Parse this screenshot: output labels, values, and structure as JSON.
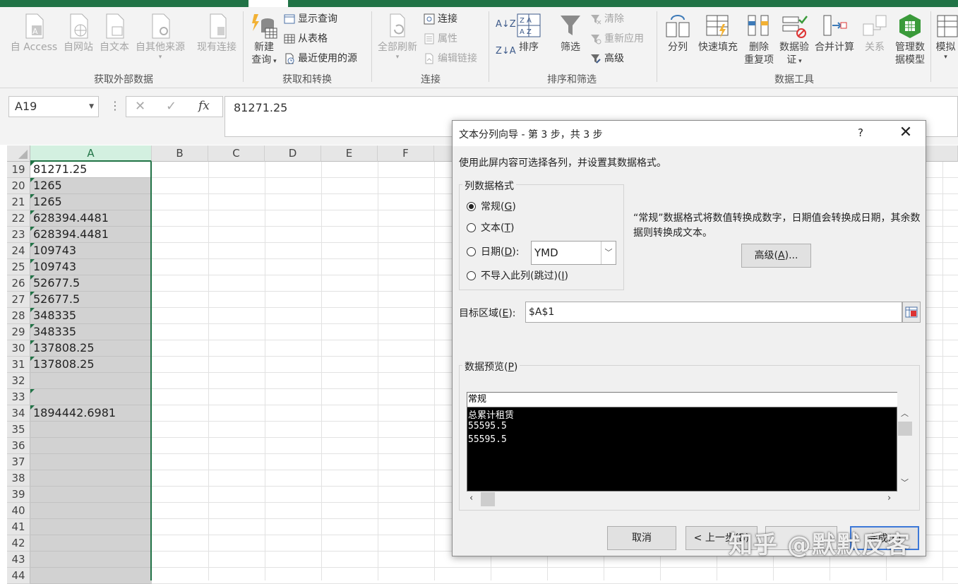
{
  "ribbon": {
    "external_data": {
      "buttons": [
        "自 Access",
        "自网站",
        "自文本",
        "自其他来源",
        "现有连接"
      ],
      "label": "获取外部数据"
    },
    "get_transform": {
      "new_query_line1": "新建",
      "new_query_line2": "查询",
      "show_queries": "显示查询",
      "from_table": "从表格",
      "recent_sources": "最近使用的源",
      "label": "获取和转换"
    },
    "connections": {
      "refresh_all": "全部刷新",
      "connections": "连接",
      "properties": "属性",
      "edit_links": "编辑链接",
      "label": "连接"
    },
    "sort_filter": {
      "sort": "排序",
      "filter": "筛选",
      "clear": "清除",
      "reapply": "重新应用",
      "advanced": "高级",
      "label": "排序和筛选"
    },
    "data_tools": {
      "split": "分列",
      "flash_fill": "快速填充",
      "remove_dup_line1": "删除",
      "remove_dup_line2": "重复项",
      "validation_line1": "数据验",
      "validation_line2": "证",
      "consolidate": "合并计算",
      "relations": "关系",
      "data_model_line1": "管理数",
      "data_model_line2": "据模型",
      "label": "数据工具"
    },
    "forecast": {
      "what_if": "模拟"
    }
  },
  "formula_bar": {
    "name_box": "A19",
    "cancel_glyph": "✕",
    "enter_glyph": "✓",
    "fx": "fx",
    "content": "81271.25"
  },
  "sheet": {
    "columns": [
      "A",
      "B",
      "C",
      "D",
      "E",
      "F"
    ],
    "rows": [
      {
        "num": "19",
        "a": "81271.25",
        "flag": true
      },
      {
        "num": "20",
        "a": "1265",
        "flag": true
      },
      {
        "num": "21",
        "a": "1265",
        "flag": true
      },
      {
        "num": "22",
        "a": "628394.4481",
        "flag": true
      },
      {
        "num": "23",
        "a": "628394.4481",
        "flag": true
      },
      {
        "num": "24",
        "a": "109743",
        "flag": true
      },
      {
        "num": "25",
        "a": "109743",
        "flag": true
      },
      {
        "num": "26",
        "a": "52677.5",
        "flag": true
      },
      {
        "num": "27",
        "a": "52677.5",
        "flag": true
      },
      {
        "num": "28",
        "a": "348335",
        "flag": true
      },
      {
        "num": "29",
        "a": "348335",
        "flag": true
      },
      {
        "num": "30",
        "a": "137808.25",
        "flag": true
      },
      {
        "num": "31",
        "a": "137808.25",
        "flag": true
      },
      {
        "num": "32",
        "a": "",
        "flag": false
      },
      {
        "num": "33",
        "a": "",
        "flag": true
      },
      {
        "num": "34",
        "a": "1894442.6981",
        "flag": true
      },
      {
        "num": "35",
        "a": "",
        "flag": false
      },
      {
        "num": "36",
        "a": "",
        "flag": false
      },
      {
        "num": "37",
        "a": "",
        "flag": false
      },
      {
        "num": "38",
        "a": "",
        "flag": false
      },
      {
        "num": "39",
        "a": "",
        "flag": false
      },
      {
        "num": "40",
        "a": "",
        "flag": false
      },
      {
        "num": "41",
        "a": "",
        "flag": false
      },
      {
        "num": "42",
        "a": "",
        "flag": false
      },
      {
        "num": "43",
        "a": "",
        "flag": false
      },
      {
        "num": "44",
        "a": "",
        "flag": false
      }
    ]
  },
  "dialog": {
    "title": "文本分列向导 - 第 3 步，共 3 步",
    "help": "?",
    "close": "✕",
    "description": "使用此屏内容可选择各列，并设置其数据格式。",
    "format_group_label": "列数据格式",
    "radio_general": {
      "text": "常规(",
      "key": "G",
      "end": ")"
    },
    "radio_text": {
      "text": "文本(",
      "key": "T",
      "end": ")"
    },
    "radio_date": {
      "text": "日期(",
      "key": "D",
      "end": "):"
    },
    "radio_skip": {
      "text": "不导入此列(跳过)(",
      "key": "I",
      "end": ")"
    },
    "date_format": "YMD",
    "format_note": "“常规”数据格式将数值转换成数字，日期值会转换成日期，其余数据则转换成文本。",
    "advanced_button": {
      "text": "高级(",
      "key": "A",
      "end": ")..."
    },
    "destination_label": {
      "text": "目标区域(",
      "key": "E",
      "end": "):"
    },
    "destination_value": "$A$1",
    "preview_label": {
      "text": "数据预览(",
      "key": "P",
      "end": ")"
    },
    "preview_header": "常规",
    "preview_lines": [
      "总累计租赁",
      "55595.5",
      "55595.5"
    ],
    "cancel_button": "取消",
    "back_button": "< 上一步(B)",
    "finish_button": "完成(F)"
  },
  "watermark": "知乎 @默默反客",
  "colors": {
    "excel_green": "#217346",
    "selected_column": "#d2d2d2",
    "preview_bg": "#000000"
  }
}
